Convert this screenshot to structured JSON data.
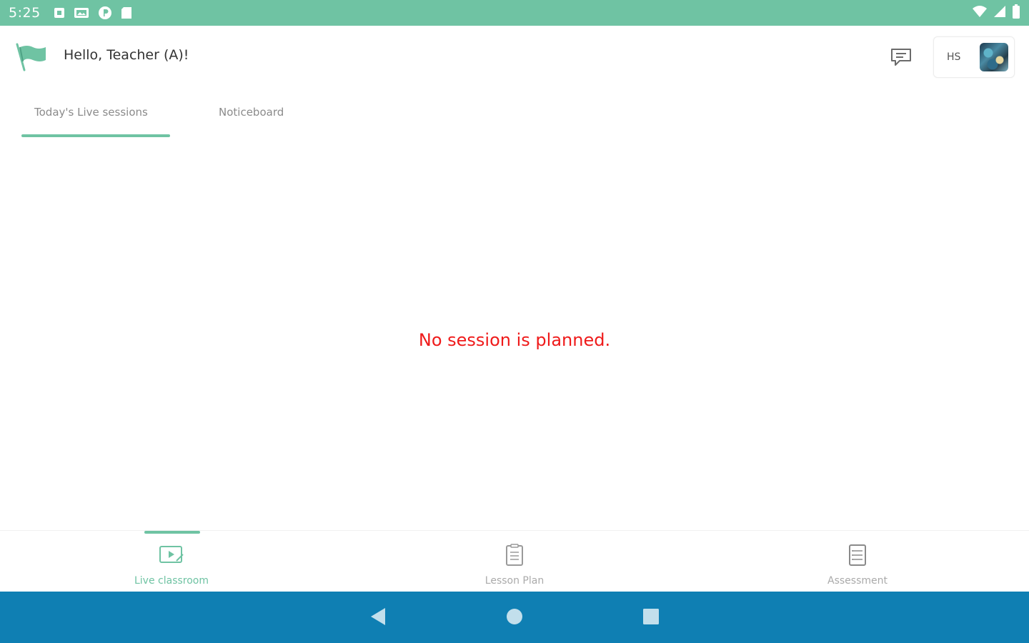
{
  "status_bar": {
    "time": "5:25",
    "left_icons": [
      "notification-square-icon",
      "gallery-icon",
      "app-p-icon",
      "sd-card-icon"
    ],
    "right_icons": [
      "wifi-icon",
      "signal-icon",
      "battery-icon"
    ]
  },
  "header": {
    "greeting": "Hello, Teacher (A)!",
    "profile_initials": "HS"
  },
  "tabs": [
    {
      "label": "Today's Live sessions",
      "active": true
    },
    {
      "label": "Noticeboard",
      "active": false
    }
  ],
  "main": {
    "empty_message": "No session is planned."
  },
  "bottom_nav": [
    {
      "label": "Live classroom",
      "icon": "live-classroom-icon",
      "active": true
    },
    {
      "label": "Lesson Plan",
      "icon": "lesson-plan-icon",
      "active": false
    },
    {
      "label": "Assessment",
      "icon": "assessment-icon",
      "active": false
    }
  ],
  "colors": {
    "accent": "#6fc3a3",
    "error_text": "#ef1a1a",
    "system_nav": "#0f7fb3"
  }
}
